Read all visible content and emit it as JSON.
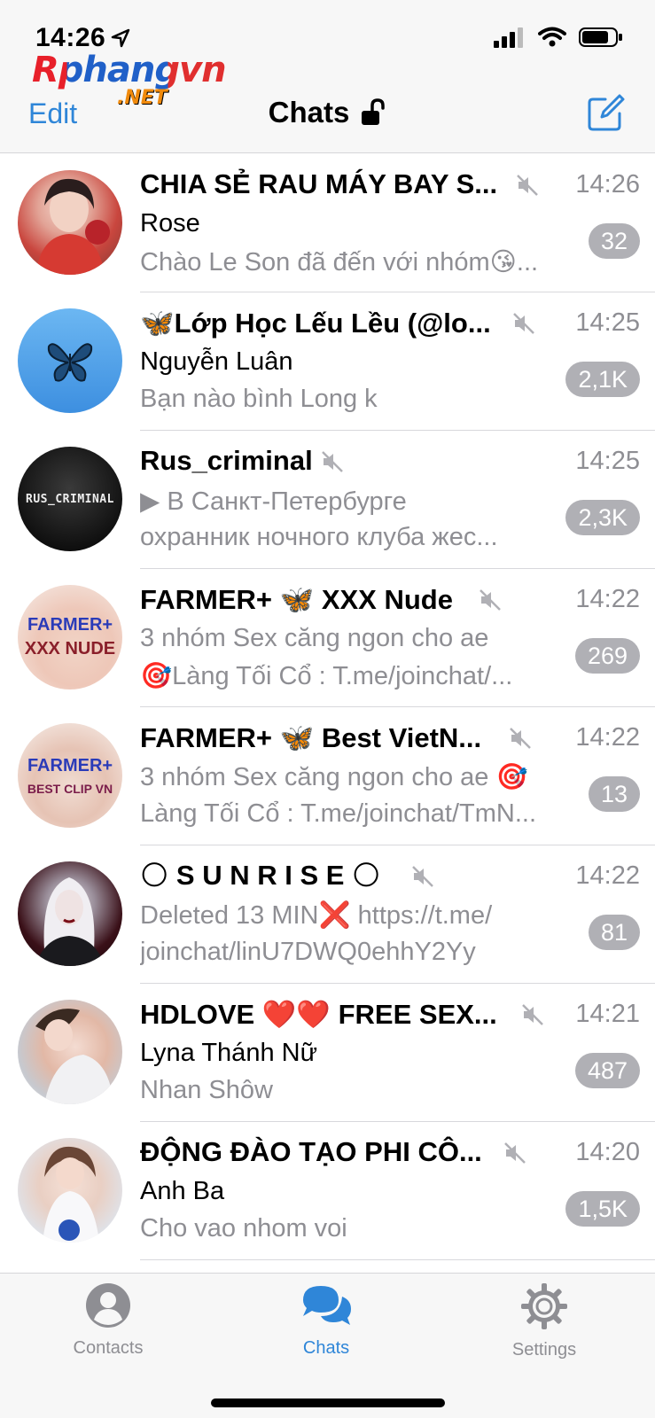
{
  "status_bar": {
    "time": "14:26"
  },
  "watermark": {
    "brand": "Rphangvn",
    "suffix": ".NET"
  },
  "header": {
    "edit_label": "Edit",
    "title": "Chats"
  },
  "chats": [
    {
      "title": "CHIA SẺ RAU MÁY BAY S...",
      "time": "14:26",
      "sender": "Rose",
      "preview": "Chào Le Son đã đến với nhóm😘...",
      "badge": "32"
    },
    {
      "title": "🦋Lớp Học Lếu Lều (@lo...",
      "time": "14:25",
      "sender": "Nguyễn Luân",
      "preview": "Bạn nào bình Long k",
      "badge": "2,1K"
    },
    {
      "title": "Rus_criminal",
      "time": "14:25",
      "line1": "▶ В Санкт-Петербурге",
      "line2": "охранник ночного клуба жес...",
      "badge": "2,3K",
      "avatar_text": "RUS_CRIMINAL"
    },
    {
      "title": "FARMER+ 🦋 XXX Nude",
      "time": "14:22",
      "line1": "3 nhóm Sex căng ngon cho ae",
      "line2": "🎯Làng Tối Cổ : T.me/joinchat/...",
      "badge": "269",
      "avatar_text_1": "FARMER+",
      "avatar_text_2": "XXX NUDE"
    },
    {
      "title": "FARMER+ 🦋 Best VietN...",
      "time": "14:22",
      "line1": "3 nhóm Sex căng ngon cho ae  🎯",
      "line2": "Làng Tối Cổ : T.me/joinchat/TmN...",
      "badge": "13",
      "avatar_text_1": "FARMER+",
      "avatar_text_2": "BEST CLIP VN"
    },
    {
      "title": "🌕 S U N R I S E 🌕",
      "time": "14:22",
      "line1": "Deleted 13 MIN❌ https://t.me/",
      "line2": "joinchat/linU7DWQ0ehhY2Yy",
      "badge": "81"
    },
    {
      "title": "HDLOVE ❤️❤️ FREE SEX...",
      "time": "14:21",
      "sender": "Lyna Thánh Nữ",
      "preview": "Nhan Shôw",
      "badge": "487"
    },
    {
      "title": "ĐỘNG ĐÀO TẠO PHI CÔ...",
      "time": "14:20",
      "sender": "Anh Ba",
      "preview": "Cho vao nhom voi",
      "badge": "1,5K"
    }
  ],
  "tabs": {
    "contacts": "Contacts",
    "chats": "Chats",
    "settings": "Settings"
  },
  "colors": {
    "accent": "#2f86d8",
    "badge": "#b0b0b5",
    "secondary_text": "#8e8e93"
  }
}
